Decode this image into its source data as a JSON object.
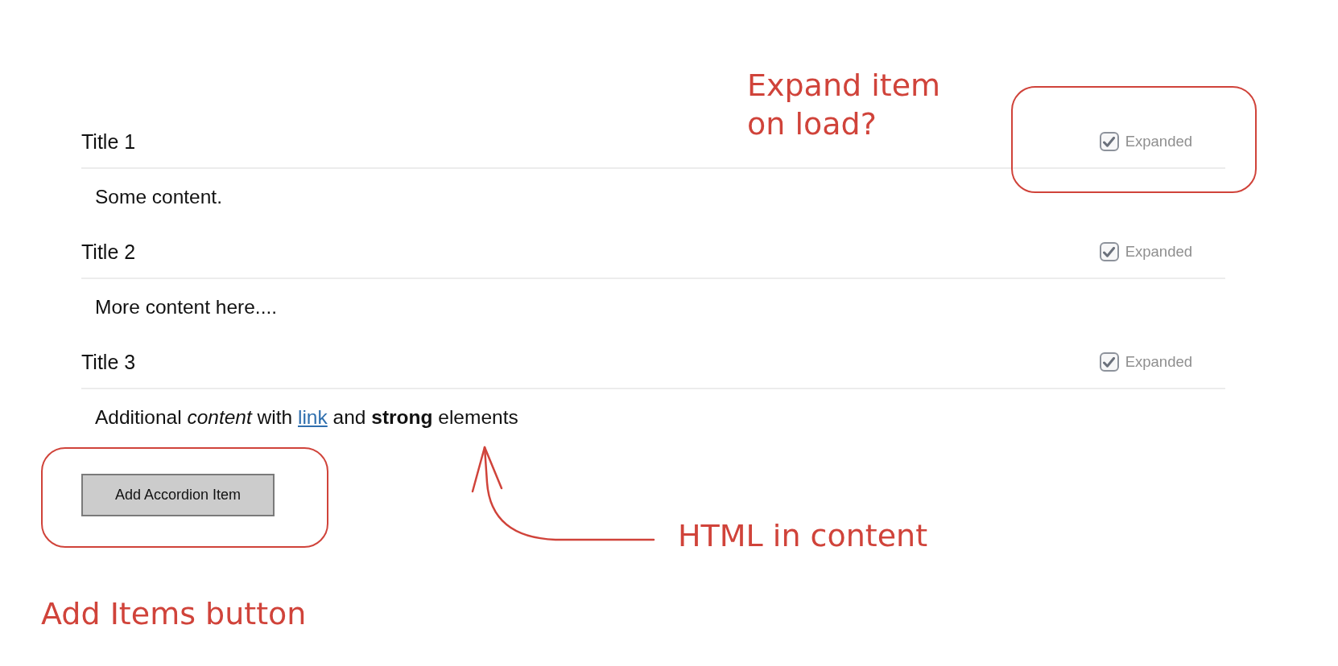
{
  "accordion": {
    "items": [
      {
        "title": "Title 1",
        "expanded": true,
        "toggle_label": "Expanded",
        "content": [
          {
            "kind": "text",
            "text": "Some content."
          }
        ]
      },
      {
        "title": "Title 2",
        "expanded": true,
        "toggle_label": "Expanded",
        "content": [
          {
            "kind": "text",
            "text": "More content here...."
          }
        ]
      },
      {
        "title": "Title 3",
        "expanded": true,
        "toggle_label": "Expanded",
        "content": [
          {
            "kind": "text",
            "text": "Additional *content* with "
          },
          {
            "kind": "link",
            "text": "link"
          },
          {
            "kind": "text",
            "text": " and **strong** elements"
          }
        ]
      }
    ]
  },
  "add_button": {
    "label": "Add Accordion Item"
  },
  "annotations": [
    {
      "kind": "note",
      "text": "Expand item on load?"
    },
    {
      "kind": "outline"
    },
    {
      "kind": "outline"
    },
    {
      "kind": "arrow"
    },
    {
      "kind": "note",
      "text": "HTML in content"
    },
    {
      "kind": "note",
      "text": "Add Items button"
    }
  ]
}
